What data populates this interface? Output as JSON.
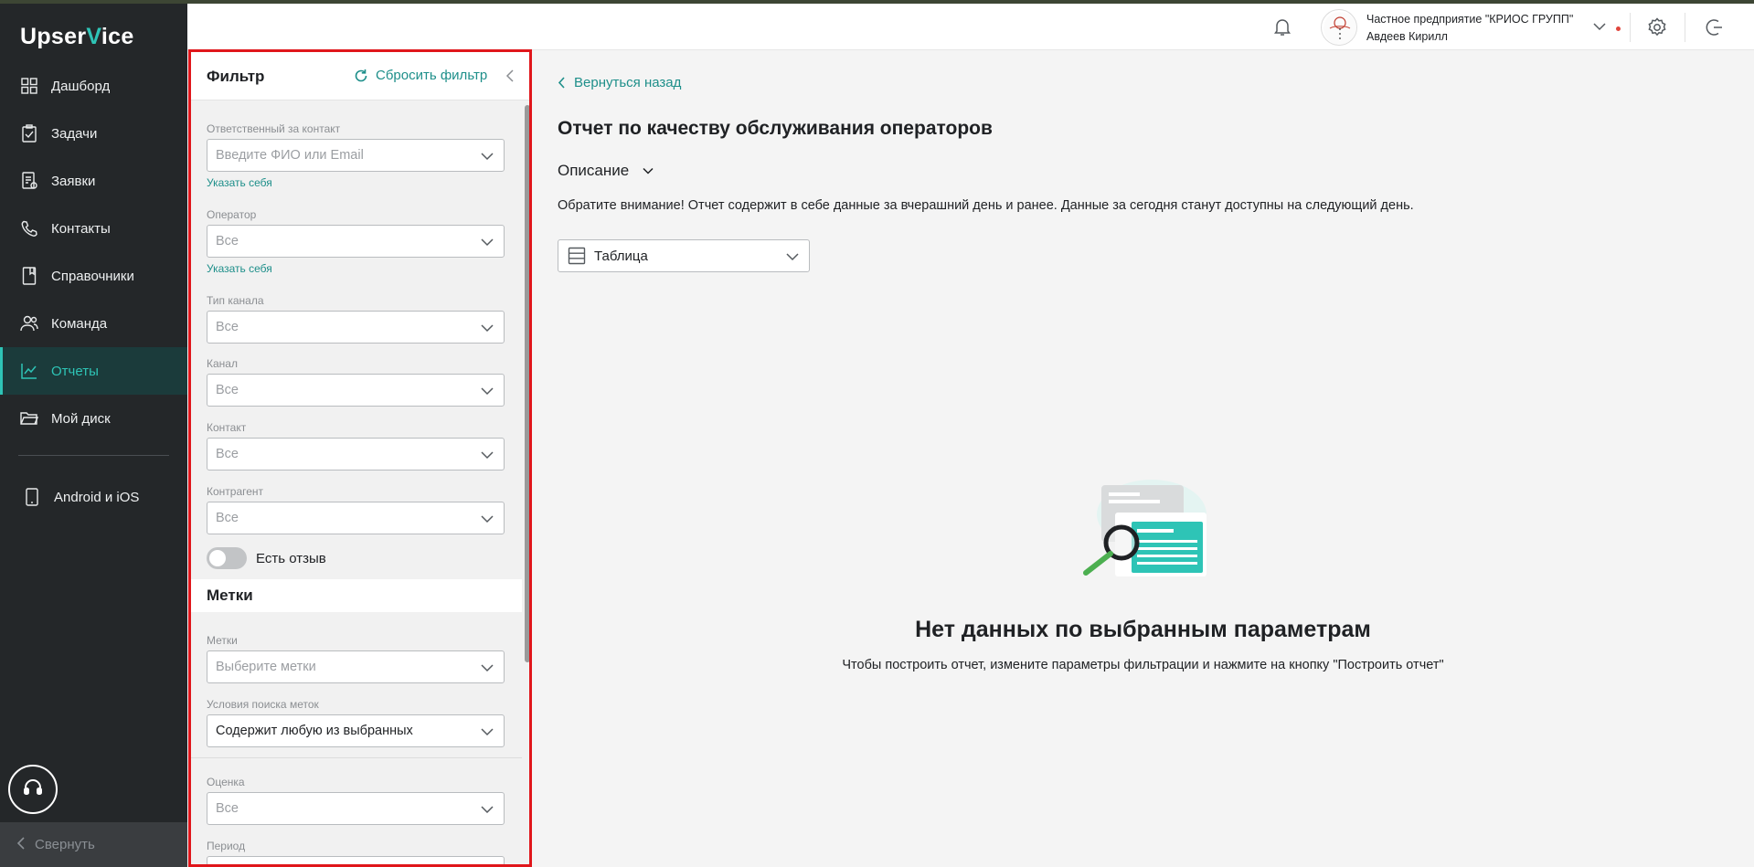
{
  "app": {
    "logo_prefix": "Upser",
    "logo_accent": "V",
    "logo_suffix": "ice"
  },
  "colors": {
    "accent": "#2ec4b6",
    "link": "#1e8f8a",
    "sidebar_bg": "#242729",
    "highlight_border": "#e0161b",
    "notification_dot": "#e0453c"
  },
  "sidebar": {
    "items": [
      {
        "label": "Дашборд",
        "icon": "dashboard-icon"
      },
      {
        "label": "Задачи",
        "icon": "tasks-icon"
      },
      {
        "label": "Заявки",
        "icon": "requests-icon"
      },
      {
        "label": "Контакты",
        "icon": "phone-icon"
      },
      {
        "label": "Справочники",
        "icon": "book-icon"
      },
      {
        "label": "Команда",
        "icon": "team-icon"
      },
      {
        "label": "Отчеты",
        "icon": "chart-icon",
        "active": true
      },
      {
        "label": "Мой диск",
        "icon": "folder-icon"
      }
    ],
    "mobile_label": "Android и iOS",
    "collapse_label": "Свернуть"
  },
  "header": {
    "org_name": "Частное предприятие \"КРИОС ГРУПП\"",
    "user_name": "Авдеев Кирилл"
  },
  "filter": {
    "title": "Фильтр",
    "reset_label": "Сбросить фильтр",
    "fields": {
      "responsible": {
        "label": "Ответственный за контакт",
        "placeholder": "Введите ФИО или Email",
        "link": "Указать себя"
      },
      "operator": {
        "label": "Оператор",
        "value": "Все",
        "link": "Указать себя"
      },
      "channel_type": {
        "label": "Тип канала",
        "value": "Все"
      },
      "channel": {
        "label": "Канал",
        "value": "Все"
      },
      "contact": {
        "label": "Контакт",
        "value": "Все"
      },
      "counterparty": {
        "label": "Контрагент",
        "value": "Все"
      },
      "has_review": {
        "label": "Есть отзыв",
        "enabled": false
      }
    },
    "tags_section_title": "Метки",
    "tags": {
      "label": "Метки",
      "placeholder": "Выберите метки"
    },
    "tag_condition": {
      "label": "Условия поиска меток",
      "value": "Содержит любую из выбранных"
    },
    "rating": {
      "label": "Оценка",
      "value": "Все"
    },
    "period": {
      "label": "Период"
    }
  },
  "main": {
    "back_label": "Вернуться назад",
    "report_title": "Отчет по качеству обслуживания операторов",
    "description_label": "Описание",
    "notice": "Обратите внимание! Отчет содержит в себе данные за вчерашний день и ранее. Данные за сегодня станут доступны на следующий день.",
    "view_mode": "Таблица",
    "empty_title": "Нет данных по выбранным параметрам",
    "empty_subtitle": "Чтобы построить отчет, измените параметры фильтрации и нажмите на кнопку \"Построить отчет\""
  }
}
